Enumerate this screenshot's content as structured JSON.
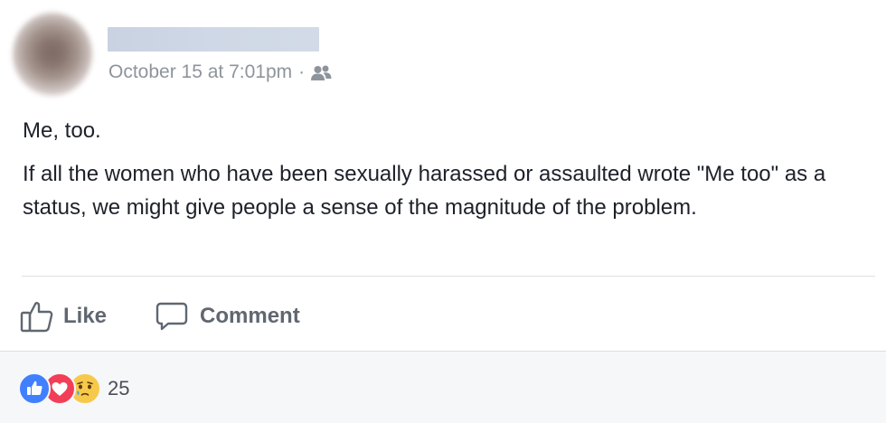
{
  "post": {
    "timestamp": "October 15 at 7:01pm",
    "separator": "·",
    "privacy_icon": "friends-icon",
    "paragraphs": [
      "Me, too.",
      "If all the women who have been sexually harassed or assaulted wrote \"Me too\" as a status, we might give people a sense of the magnitude of the problem."
    ]
  },
  "actions": {
    "like_label": "Like",
    "comment_label": "Comment"
  },
  "reactions": {
    "types": [
      "like",
      "love",
      "sad"
    ],
    "count": "25"
  },
  "colors": {
    "text": "#1d2129",
    "meta": "#8e949c",
    "action": "#606770",
    "like_reaction": "#4080ff",
    "love_reaction": "#f33e58",
    "sad_reaction": "#f7c94b",
    "footer_bg": "#f6f7f9"
  }
}
